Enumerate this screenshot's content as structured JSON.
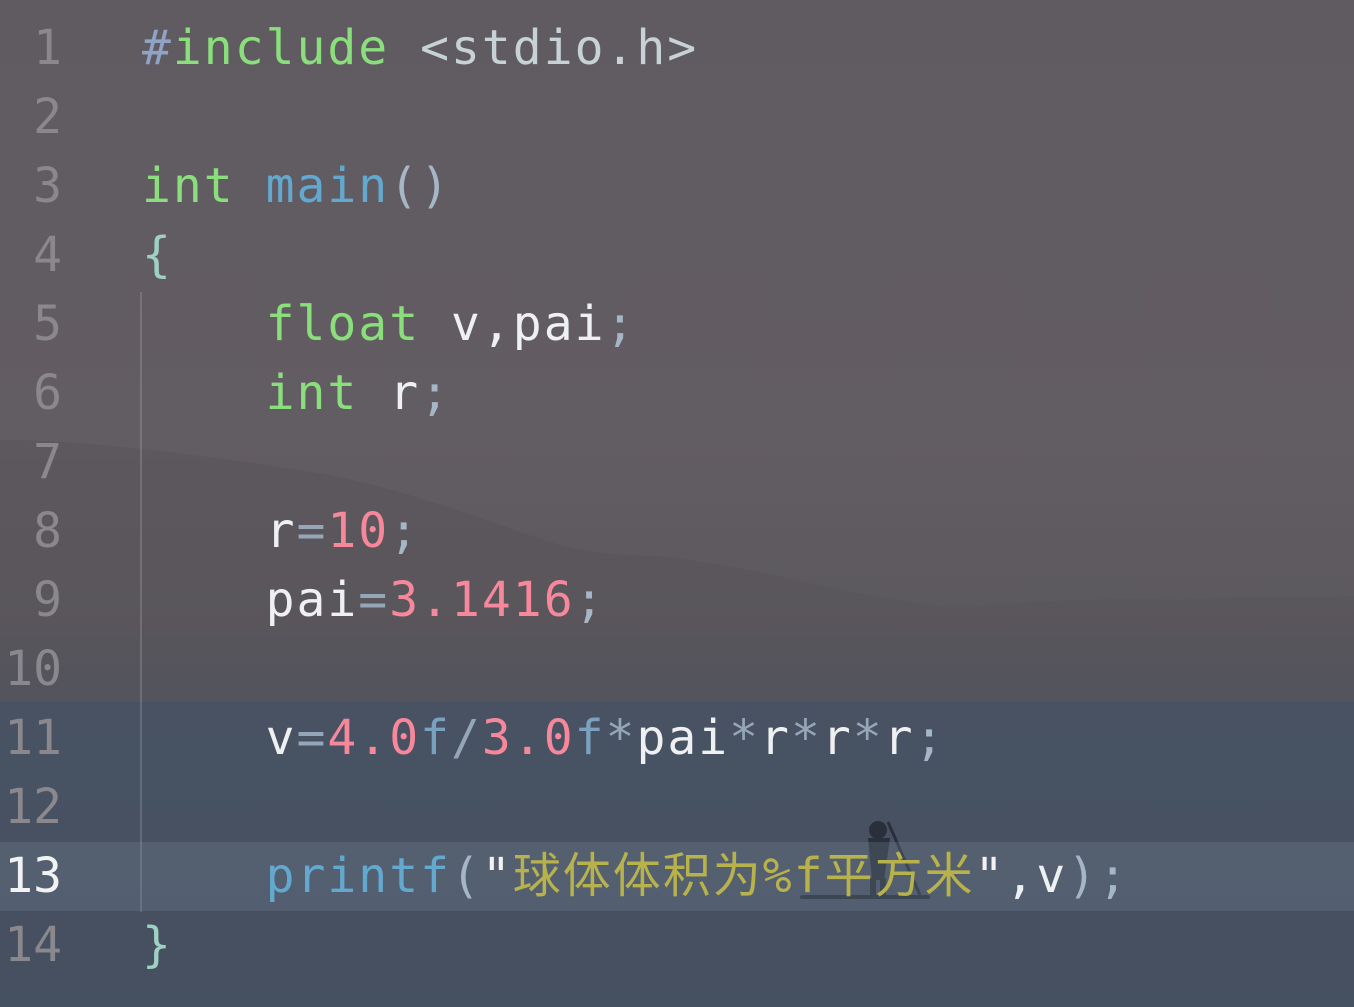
{
  "editor": {
    "language": "c",
    "current_line": 13,
    "colors": {
      "preprocessor": "#8ea3c6",
      "keyword": "#8adf7c",
      "function": "#63a9cf",
      "number": "#f7879b",
      "string": "#b7b24c",
      "identifier": "#eef0f2",
      "line_number": "#8a878d",
      "line_number_active": "#f2f2f2"
    },
    "lines": [
      {
        "n": "1",
        "tokens": [
          {
            "t": "#",
            "c": "pp"
          },
          {
            "t": "include",
            "c": "kw"
          },
          {
            "t": " ",
            "c": "var"
          },
          {
            "t": "<stdio.h>",
            "c": "hdr"
          }
        ]
      },
      {
        "n": "2",
        "tokens": []
      },
      {
        "n": "3",
        "tokens": [
          {
            "t": "int",
            "c": "kw"
          },
          {
            "t": " ",
            "c": "var"
          },
          {
            "t": "main",
            "c": "fn"
          },
          {
            "t": "()",
            "c": "pun"
          }
        ]
      },
      {
        "n": "4",
        "tokens": [
          {
            "t": "{",
            "c": "brace"
          }
        ]
      },
      {
        "n": "5",
        "tokens": [
          {
            "t": "    ",
            "c": "var"
          },
          {
            "t": "float",
            "c": "kw"
          },
          {
            "t": " v,pai",
            "c": "var"
          },
          {
            "t": ";",
            "c": "pun"
          }
        ]
      },
      {
        "n": "6",
        "tokens": [
          {
            "t": "    ",
            "c": "var"
          },
          {
            "t": "int",
            "c": "kw"
          },
          {
            "t": " r",
            "c": "var"
          },
          {
            "t": ";",
            "c": "pun"
          }
        ]
      },
      {
        "n": "7",
        "tokens": []
      },
      {
        "n": "8",
        "tokens": [
          {
            "t": "    ",
            "c": "var"
          },
          {
            "t": "r",
            "c": "var"
          },
          {
            "t": "=",
            "c": "op"
          },
          {
            "t": "10",
            "c": "num"
          },
          {
            "t": ";",
            "c": "pun"
          }
        ]
      },
      {
        "n": "9",
        "tokens": [
          {
            "t": "    ",
            "c": "var"
          },
          {
            "t": "pai",
            "c": "var"
          },
          {
            "t": "=",
            "c": "op"
          },
          {
            "t": "3.1416",
            "c": "num"
          },
          {
            "t": ";",
            "c": "pun"
          }
        ]
      },
      {
        "n": "10",
        "tokens": []
      },
      {
        "n": "11",
        "tokens": [
          {
            "t": "    ",
            "c": "var"
          },
          {
            "t": "v",
            "c": "var"
          },
          {
            "t": "=",
            "c": "op"
          },
          {
            "t": "4.0",
            "c": "num"
          },
          {
            "t": "f",
            "c": "suf"
          },
          {
            "t": "/",
            "c": "op"
          },
          {
            "t": "3.0",
            "c": "num"
          },
          {
            "t": "f",
            "c": "suf"
          },
          {
            "t": "*",
            "c": "op"
          },
          {
            "t": "pai",
            "c": "var"
          },
          {
            "t": "*",
            "c": "op"
          },
          {
            "t": "r",
            "c": "var"
          },
          {
            "t": "*",
            "c": "op"
          },
          {
            "t": "r",
            "c": "var"
          },
          {
            "t": "*",
            "c": "op"
          },
          {
            "t": "r",
            "c": "var"
          },
          {
            "t": ";",
            "c": "pun"
          }
        ]
      },
      {
        "n": "12",
        "tokens": []
      },
      {
        "n": "13",
        "tokens": [
          {
            "t": "    ",
            "c": "var"
          },
          {
            "t": "printf",
            "c": "fn"
          },
          {
            "t": "(",
            "c": "pun"
          },
          {
            "t": "\"",
            "c": "quote"
          },
          {
            "t": "球体体积为%f平方米",
            "c": "str"
          },
          {
            "t": "\"",
            "c": "quote"
          },
          {
            "t": ",v",
            "c": "var"
          },
          {
            "t": ");",
            "c": "pun"
          }
        ]
      },
      {
        "n": "14",
        "tokens": [
          {
            "t": "}",
            "c": "brace"
          }
        ]
      }
    ]
  }
}
